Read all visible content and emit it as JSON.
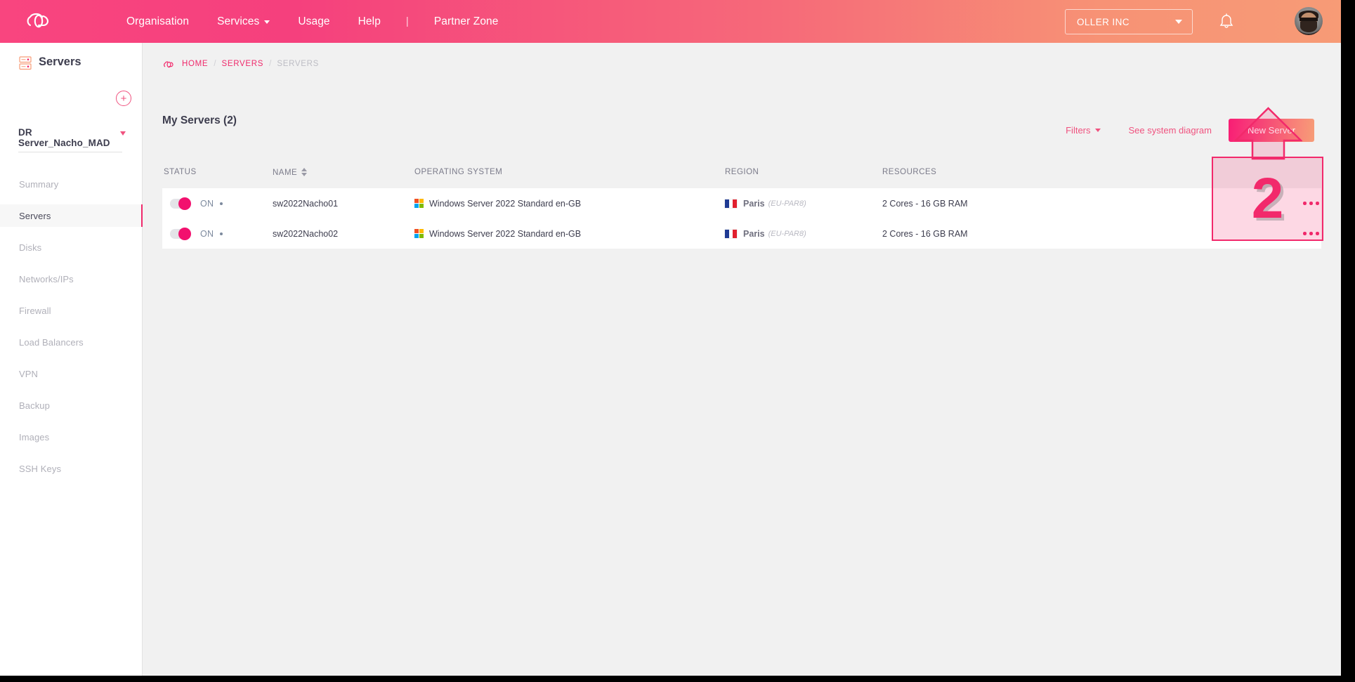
{
  "colors": {
    "brand_pink": "#f2296b",
    "brand_pink_light": "#f0527f",
    "brand_salmon": "#f79c77",
    "text_dark": "#3d3d4e",
    "text_muted": "#b0b0b9",
    "page_bg": "#f1f1f1"
  },
  "header": {
    "logo_icon": "cloud-logo-icon",
    "nav": [
      {
        "label": "Organisation",
        "has_caret": false
      },
      {
        "label": "Services",
        "has_caret": true
      },
      {
        "label": "Usage",
        "has_caret": false
      },
      {
        "label": "Help",
        "has_caret": false
      }
    ],
    "separator": "|",
    "partner_zone_label": "Partner Zone",
    "org_selector": {
      "value": "OLLER INC",
      "icon": "chevron-down-icon"
    },
    "notifications_icon": "bell-icon",
    "avatar_icon": "user-avatar"
  },
  "sidebar": {
    "section_icon": "server-rack-icon",
    "section_title": "Servers",
    "add_button_label": "+",
    "project_selector": {
      "value": "DR Server_Nacho_MAD",
      "icon": "chevron-down-icon"
    },
    "items": [
      {
        "label": "Summary",
        "active": false
      },
      {
        "label": "Servers",
        "active": true
      },
      {
        "label": "Disks",
        "active": false
      },
      {
        "label": "Networks/IPs",
        "active": false
      },
      {
        "label": "Firewall",
        "active": false
      },
      {
        "label": "Load Balancers",
        "active": false
      },
      {
        "label": "VPN",
        "active": false
      },
      {
        "label": "Backup",
        "active": false
      },
      {
        "label": "Images",
        "active": false
      },
      {
        "label": "SSH Keys",
        "active": false
      }
    ]
  },
  "breadcrumb": {
    "icon": "cloud-logo-icon",
    "items": [
      {
        "label": "HOME",
        "current": false
      },
      {
        "label": "SERVERS",
        "current": false
      },
      {
        "label": "SERVERS",
        "current": true
      }
    ],
    "separator": "/"
  },
  "page": {
    "title": "My Servers (2)"
  },
  "toolbar": {
    "filters_label": "Filters",
    "filters_icon": "chevron-down-icon",
    "system_diagram_label": "See system diagram",
    "new_server_label": "New Server"
  },
  "table": {
    "columns": [
      {
        "key": "status",
        "label": "STATUS",
        "sortable": false
      },
      {
        "key": "name",
        "label": "NAME",
        "sortable": true
      },
      {
        "key": "os",
        "label": "OPERATING SYSTEM",
        "sortable": false
      },
      {
        "key": "region",
        "label": "REGION",
        "sortable": false
      },
      {
        "key": "resources",
        "label": "RESOURCES",
        "sortable": false
      }
    ],
    "rows": [
      {
        "status_toggle": "on",
        "status_label": "ON",
        "name": "sw2022Nacho01",
        "os_icon": "windows-logo-icon",
        "os": "Windows Server 2022 Standard en-GB",
        "region_flag": "france-flag-icon",
        "region_city": "Paris",
        "region_code": "(EU-PAR8)",
        "resources": "2 Cores - 16 GB RAM",
        "menu_icon": "more-options-icon"
      },
      {
        "status_toggle": "on",
        "status_label": "ON",
        "name": "sw2022Nacho02",
        "os_icon": "windows-logo-icon",
        "os": "Windows Server 2022 Standard en-GB",
        "region_flag": "france-flag-icon",
        "region_city": "Paris",
        "region_code": "(EU-PAR8)",
        "resources": "2 Cores - 16 GB RAM",
        "menu_icon": "more-options-icon"
      }
    ]
  },
  "annotation": {
    "step_number": "2",
    "arrow_icon": "up-arrow-annotation-icon"
  }
}
